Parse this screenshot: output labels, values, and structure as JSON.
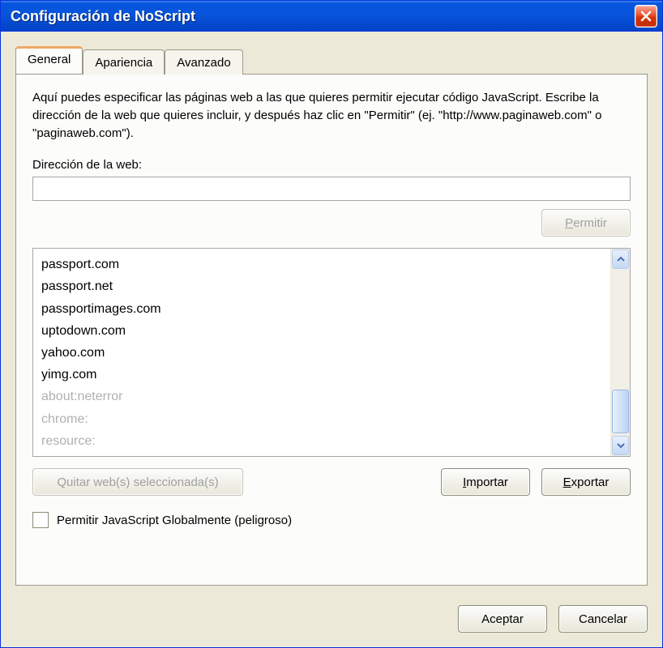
{
  "window": {
    "title": "Configuración de NoScript"
  },
  "tabs": [
    {
      "label": "General",
      "active": true
    },
    {
      "label": "Apariencia",
      "active": false
    },
    {
      "label": "Avanzado",
      "active": false
    }
  ],
  "panel": {
    "description": "Aquí puedes especificar las páginas web a las que quieres permitir ejecutar código JavaScript. Escribe la dirección de la web que quieres incluir, y después haz clic en \"Permitir\" (ej. \"http://www.paginaweb.com\" o \"paginaweb.com\").",
    "address_label": "Dirección de la web:",
    "address_value": "",
    "permit_button": "Permitir",
    "permit_button_accesskey": "P",
    "sites": [
      {
        "text": "passport.com",
        "muted": false
      },
      {
        "text": "passport.net",
        "muted": false
      },
      {
        "text": "passportimages.com",
        "muted": false
      },
      {
        "text": "uptodown.com",
        "muted": false
      },
      {
        "text": "yahoo.com",
        "muted": false
      },
      {
        "text": "yimg.com",
        "muted": false
      },
      {
        "text": "about:neterror",
        "muted": true
      },
      {
        "text": "chrome:",
        "muted": true
      },
      {
        "text": "resource:",
        "muted": true
      }
    ],
    "remove_button": "Quitar web(s) seleccionada(s)",
    "import_button": "Importar",
    "import_button_accesskey": "I",
    "export_button": "Exportar",
    "export_button_accesskey": "E",
    "global_checkbox_label": "Permitir JavaScript Globalmente (peligroso)",
    "global_checked": false
  },
  "footer": {
    "accept": "Aceptar",
    "cancel": "Cancelar"
  },
  "icons": {
    "close": "close-icon",
    "scroll_up": "chevron-up-icon",
    "scroll_down": "chevron-down-icon"
  }
}
